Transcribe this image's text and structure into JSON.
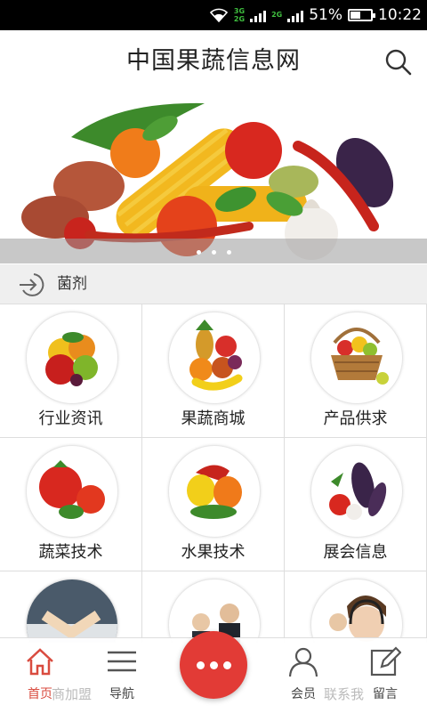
{
  "status_bar": {
    "network_top": "3G",
    "network_bottom": "2G",
    "network_2": "2G",
    "battery": "51%",
    "time": "10:22"
  },
  "header": {
    "title": "中国果蔬信息网",
    "search_icon": "search-icon"
  },
  "banner": {
    "image": "vegetable-assortment",
    "dots": 3
  },
  "category_bar": {
    "icon": "enter-arrow-icon",
    "label": "菌剂"
  },
  "grid": [
    {
      "label": "行业资讯",
      "icon": "mixed-fruit"
    },
    {
      "label": "果蔬商城",
      "icon": "fruit-pile"
    },
    {
      "label": "产品供求",
      "icon": "fruit-basket"
    },
    {
      "label": "蔬菜技术",
      "icon": "tomatoes"
    },
    {
      "label": "水果技术",
      "icon": "bell-peppers"
    },
    {
      "label": "展会信息",
      "icon": "eggplant-vegetables"
    },
    {
      "label": "",
      "icon": "business-handshake"
    },
    {
      "label": "",
      "icon": "business-people"
    },
    {
      "label": "",
      "icon": "call-center-woman"
    }
  ],
  "bottom_nav": {
    "items": [
      {
        "label": "首页",
        "icon": "home-icon",
        "active": true
      },
      {
        "label": "导航",
        "icon": "menu-icon"
      },
      {
        "label": "会员",
        "icon": "user-icon"
      },
      {
        "label": "留言",
        "icon": "edit-icon"
      }
    ],
    "behind_labels": [
      "商加盟",
      "联系我"
    ],
    "fab_icon": "more-dots-icon"
  },
  "colors": {
    "accent": "#e23b36",
    "active_nav": "#d94b3f",
    "category_bg": "#efefef"
  }
}
